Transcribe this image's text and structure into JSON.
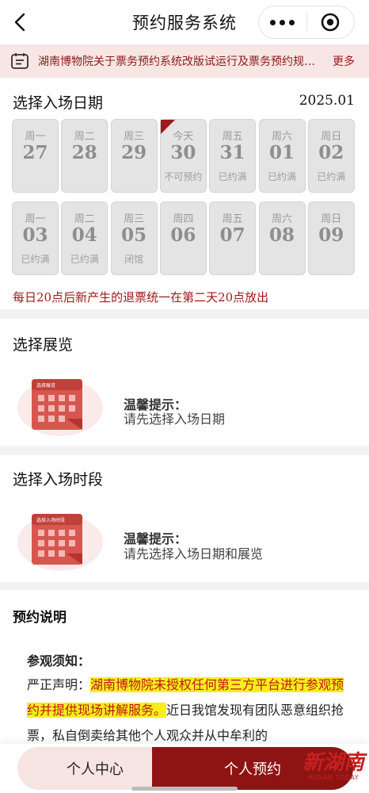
{
  "nav": {
    "title": "预约服务系统",
    "back_icon": "chevron-left-icon",
    "more_icon": "more-dots-icon",
    "close_icon": "target-close-icon"
  },
  "notice": {
    "text": "湖南博物院关于票务预约系统改版试运行及票务预约规…",
    "more": "更多",
    "icon": "notice-list-icon"
  },
  "date_section": {
    "title": "选择入场日期",
    "year_month": "2025.01",
    "days": [
      {
        "weekday": "周一",
        "day": "27",
        "status": ""
      },
      {
        "weekday": "周二",
        "day": "28",
        "status": ""
      },
      {
        "weekday": "周三",
        "day": "29",
        "status": ""
      },
      {
        "weekday": "今天",
        "day": "30",
        "status": "不可预约",
        "today": true
      },
      {
        "weekday": "周五",
        "day": "31",
        "status": "已约满"
      },
      {
        "weekday": "周六",
        "day": "01",
        "status": "已约满"
      },
      {
        "weekday": "周日",
        "day": "02",
        "status": "已约满"
      },
      {
        "weekday": "周一",
        "day": "03",
        "status": "已约满"
      },
      {
        "weekday": "周二",
        "day": "04",
        "status": "已约满"
      },
      {
        "weekday": "周三",
        "day": "05",
        "status": "闭馆"
      },
      {
        "weekday": "周四",
        "day": "06",
        "status": ""
      },
      {
        "weekday": "周五",
        "day": "07",
        "status": ""
      },
      {
        "weekday": "周六",
        "day": "08",
        "status": ""
      },
      {
        "weekday": "周日",
        "day": "09",
        "status": ""
      }
    ],
    "refund_note": "每日20点后新产生的退票统一在第二天20点放出",
    "accent_color": "#a11818"
  },
  "exhibition_section": {
    "title": "选择展览",
    "illustration_label": "选择展览",
    "tip_title": "温馨提示：",
    "tip_text": "请先选择入场日期"
  },
  "time_section": {
    "title": "选择入场时段",
    "illustration_label": "选择入场时段",
    "tip_title": "温馨提示：",
    "tip_text": "请先选择入场日期和展览"
  },
  "info_section": {
    "title": "预约说明",
    "notice_head": "参观须知：",
    "p_lead": "严正声明：",
    "p_highlight": "湖南博物院未授权任何第三方平台进行参观预约并提供现场讲解服务。",
    "p_rest": "近日我馆发现有团队恶意组织抢票，私自倒卖给其他个人观众并从中牟利的"
  },
  "tabbar": {
    "left": "个人中心",
    "right": "个人预约",
    "brand_color": "#8e1414"
  },
  "watermark": {
    "cn": "新湖南",
    "en": "HUNAN TODAY"
  }
}
